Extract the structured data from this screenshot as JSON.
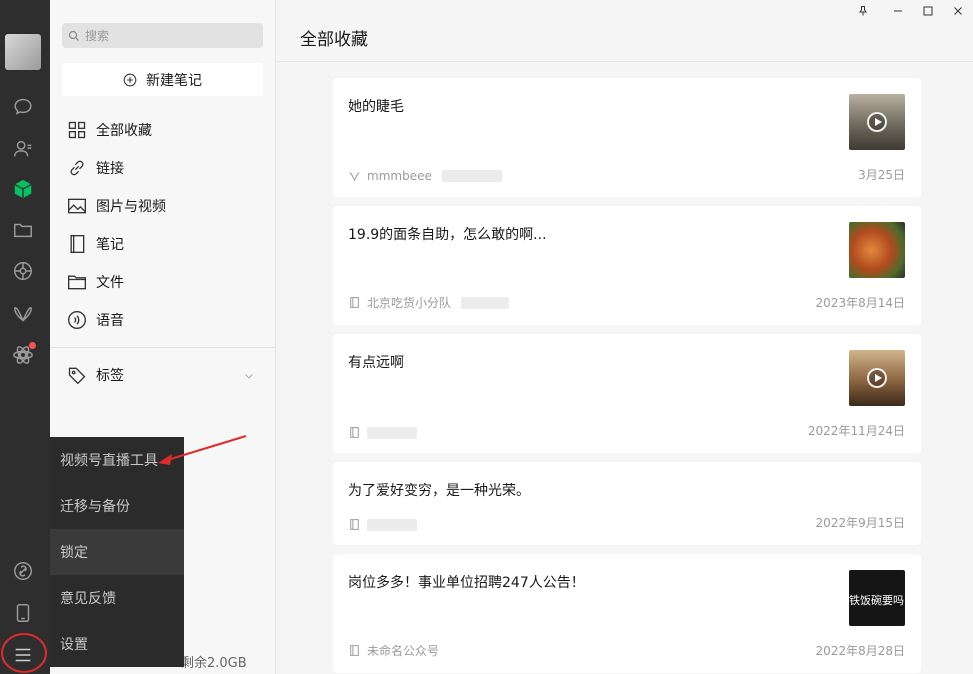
{
  "sidebar": {
    "search_placeholder": "搜索",
    "new_note_label": "新建笔记",
    "items": [
      {
        "label": "全部收藏",
        "icon": "grid-icon"
      },
      {
        "label": "链接",
        "icon": "link-icon"
      },
      {
        "label": "图片与视频",
        "icon": "image-icon"
      },
      {
        "label": "笔记",
        "icon": "note-icon"
      },
      {
        "label": "文件",
        "icon": "folder-icon"
      },
      {
        "label": "语音",
        "icon": "voice-icon"
      }
    ],
    "tags_label": "标签",
    "storage_text": "剩余2.0GB"
  },
  "popup_menu": {
    "items": [
      "视频号直播工具",
      "迁移与备份",
      "锁定",
      "意见反馈",
      "设置"
    ]
  },
  "main": {
    "title": "全部收藏",
    "cards": [
      {
        "title": "她的睫毛",
        "source": "mmmbeee",
        "date": "3月25日",
        "thumb": "video"
      },
      {
        "title": "19.9的面条自助，怎么敢的啊...",
        "source": "北京吃货小分队",
        "date": "2023年8月14日",
        "thumb": "food"
      },
      {
        "title": "有点远啊",
        "source": "",
        "date": "2022年11月24日",
        "thumb": "video"
      },
      {
        "title": "为了爱好变穷，是一种光荣。",
        "source": "",
        "date": "2022年9月15日",
        "thumb": "none"
      },
      {
        "title": "岗位多多！事业单位招聘247人公告！",
        "source": "未命名公众号",
        "date": "2022年8月28日",
        "thumb": "text",
        "thumb_text": "铁饭碗要吗"
      }
    ]
  },
  "colors": {
    "rail_bg": "#2e2e2e",
    "accent_green": "#07c160",
    "notification_red": "#fa5151",
    "annotation_red": "#e02b2b"
  }
}
